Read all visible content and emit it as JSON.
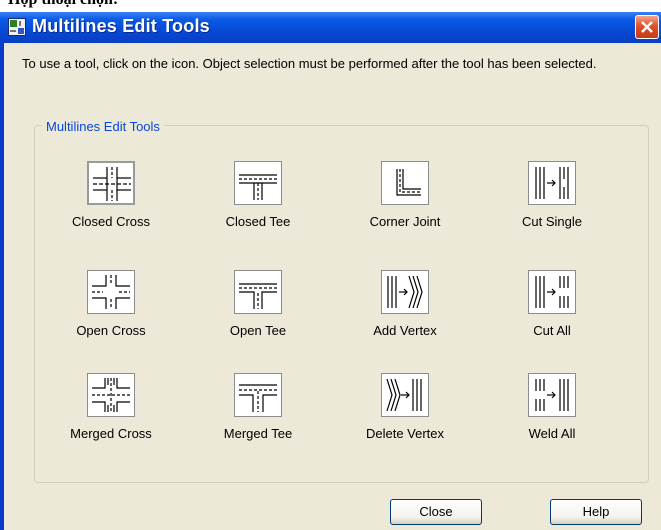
{
  "top_text": "Hộp thoại chọn:",
  "window": {
    "title": "Multilines Edit Tools"
  },
  "instruction": "To use a tool, click on the icon.  Object selection must be performed after the tool has been selected.",
  "group_label": "Multilines Edit Tools",
  "tools": [
    {
      "label": "Closed Cross",
      "icon": "closed-cross-icon",
      "selected": true
    },
    {
      "label": "Closed Tee",
      "icon": "closed-tee-icon"
    },
    {
      "label": "Corner Joint",
      "icon": "corner-joint-icon"
    },
    {
      "label": "Cut Single",
      "icon": "cut-single-icon"
    },
    {
      "label": "Open Cross",
      "icon": "open-cross-icon"
    },
    {
      "label": "Open Tee",
      "icon": "open-tee-icon"
    },
    {
      "label": "Add Vertex",
      "icon": "add-vertex-icon"
    },
    {
      "label": "Cut All",
      "icon": "cut-all-icon"
    },
    {
      "label": "Merged Cross",
      "icon": "merged-cross-icon"
    },
    {
      "label": "Merged Tee",
      "icon": "merged-tee-icon"
    },
    {
      "label": "Delete Vertex",
      "icon": "delete-vertex-icon"
    },
    {
      "label": "Weld All",
      "icon": "weld-all-icon"
    }
  ],
  "buttons": {
    "close": "Close",
    "help": "Help"
  },
  "colors": {
    "title_bar": "#0a5ae6",
    "dialog_bg": "#ece9d8",
    "group_label": "#0a46d4",
    "close_x": "#e0512c"
  }
}
